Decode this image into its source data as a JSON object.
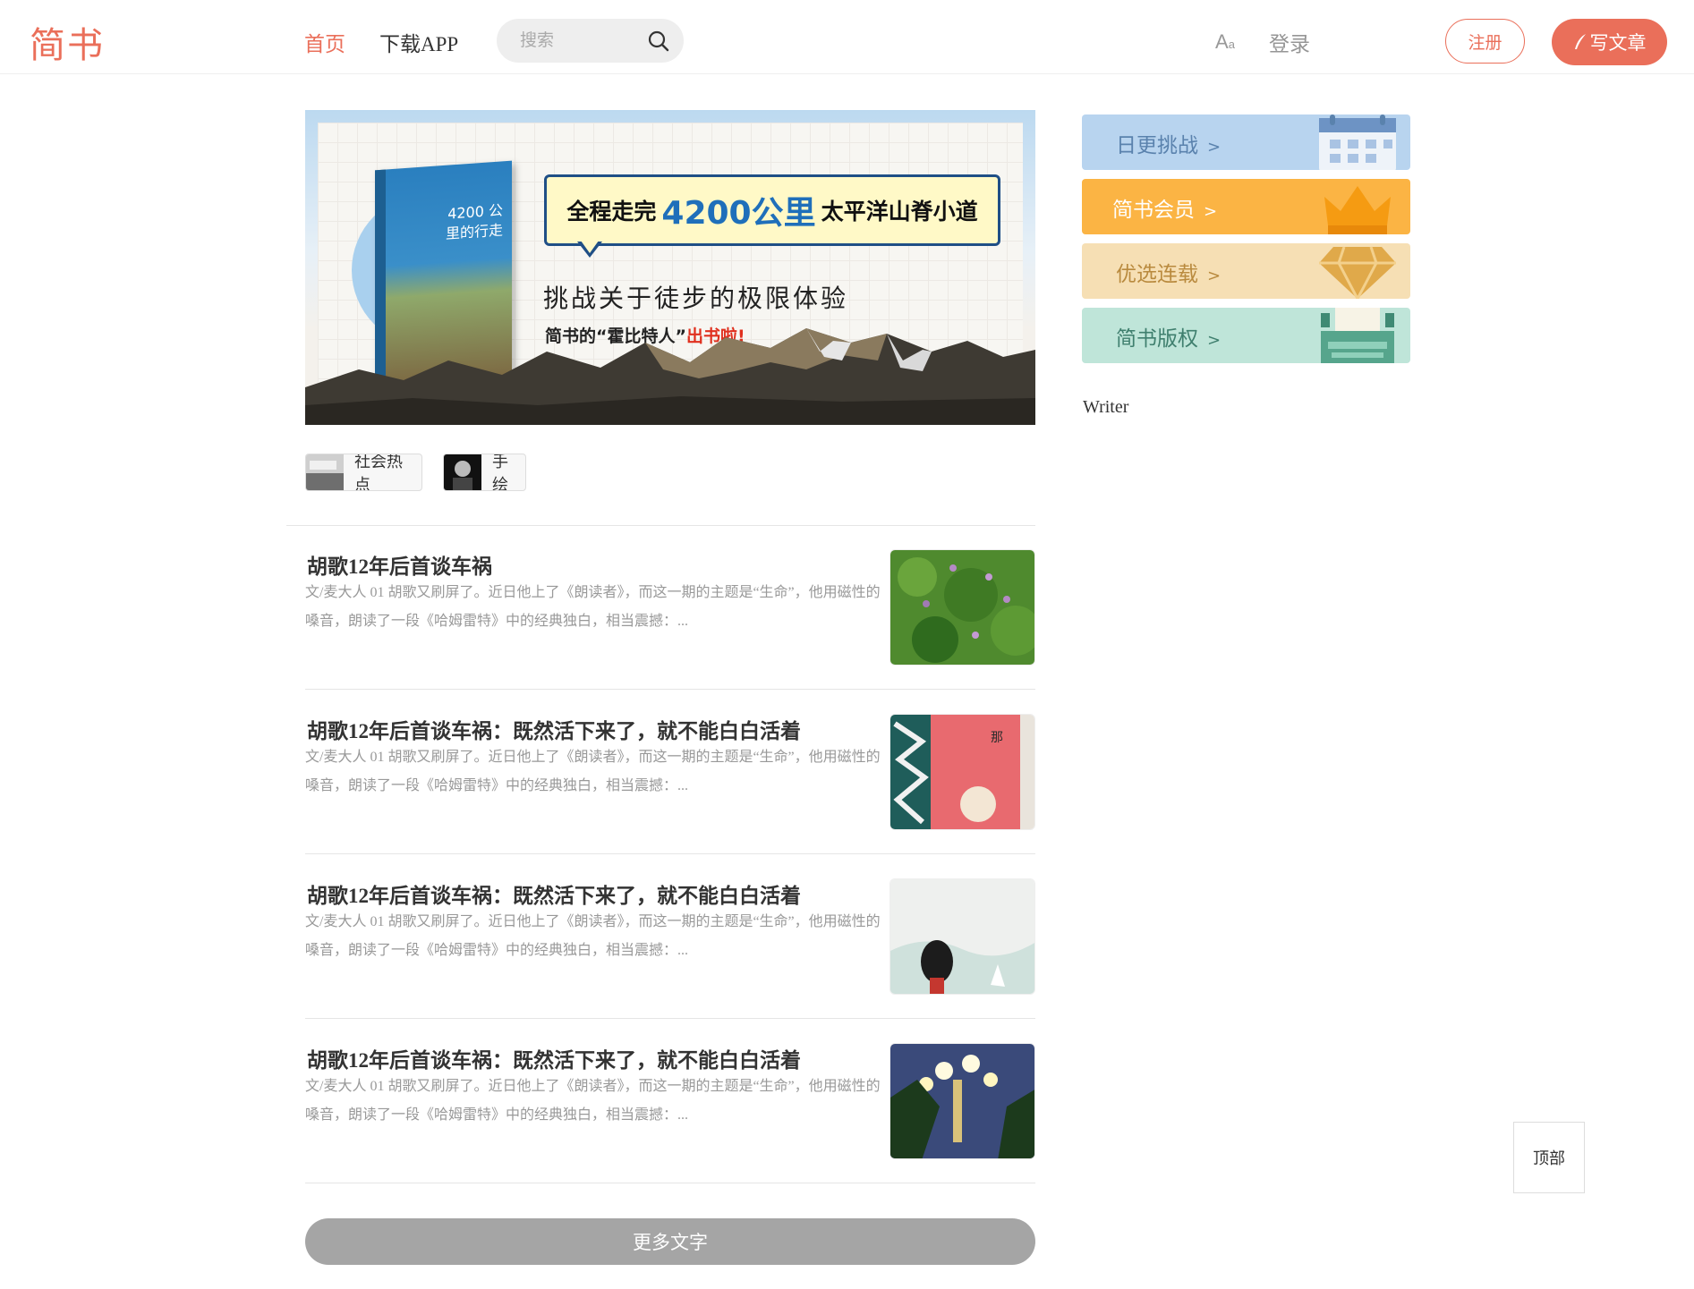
{
  "header": {
    "logo": "简书",
    "nav_home": "首页",
    "nav_app": "下载APP",
    "search_placeholder": "搜索",
    "font_toggle": "Aa",
    "login": "登录",
    "register": "注册",
    "write": "写文章"
  },
  "banner": {
    "headline_pre": "全程走完",
    "headline_big": "4200公里",
    "headline_post": "太平洋山脊小道",
    "subline": "挑战关于徒步的极限体验",
    "subline2_pre": "简书的“霍比特人”",
    "subline2_red": "出书啦!",
    "book_title": "4200 公里的行走"
  },
  "tags": [
    {
      "label": "社会热点"
    },
    {
      "label": "手绘"
    }
  ],
  "articles": [
    {
      "title": "胡歌12年后首谈车祸",
      "abstract": "文/麦大人 01 胡歌又刷屏了。近日他上了《朗读者》，而这一期的主题是“生命”，他用磁性的嗓音，朗读了一段《哈姆雷特》中的经典独白，相当震撼：..."
    },
    {
      "title": "胡歌12年后首谈车祸：既然活下来了，就不能白白活着",
      "abstract": "文/麦大人 01 胡歌又刷屏了。近日他上了《朗读者》，而这一期的主题是“生命”，他用磁性的嗓音，朗读了一段《哈姆雷特》中的经典独白，相当震撼：..."
    },
    {
      "title": "胡歌12年后首谈车祸：既然活下来了，就不能白白活着",
      "abstract": "文/麦大人 01 胡歌又刷屏了。近日他上了《朗读者》，而这一期的主题是“生命”，他用磁性的嗓音，朗读了一段《哈姆雷特》中的经典独白，相当震撼：..."
    },
    {
      "title": "胡歌12年后首谈车祸：既然活下来了，就不能白白活着",
      "abstract": "文/麦大人 01 胡歌又刷屏了。近日他上了《朗读者》，而这一期的主题是“生命”，他用磁性的嗓音，朗读了一段《哈姆雷特》中的经典独白，相当震撼：..."
    }
  ],
  "more_button": "更多文字",
  "sidebar": {
    "cards": [
      {
        "label": "日更挑战",
        "icon": "calendar-icon",
        "bg": "#b8d4ef",
        "color": "#5a82ad"
      },
      {
        "label": "简书会员",
        "icon": "crown-icon",
        "bg": "#fbb444",
        "color": "#ffffff"
      },
      {
        "label": "优选连载",
        "icon": "diamond-icon",
        "bg": "#f6dfb4",
        "color": "#b98a3e"
      },
      {
        "label": "简书版权",
        "icon": "typewriter-icon",
        "bg": "#bfe5d9",
        "color": "#3f7f6e"
      }
    ],
    "writer_label": "Writer"
  },
  "top_button": "顶部",
  "colors": {
    "accent": "#ea6f5a",
    "more_button": "#a5a5a5"
  }
}
